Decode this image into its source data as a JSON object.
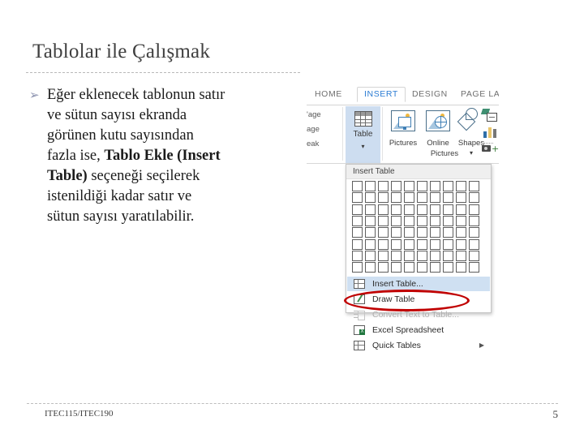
{
  "slide": {
    "title": "Tablolar ile Çalışmak",
    "bullet_marker": "➢",
    "body_lines": [
      {
        "text": "Eğer eklenecek tablonun satır",
        "bold": false
      },
      {
        "text": "ve sütun sayısı ekranda",
        "bold": false
      },
      {
        "text": "görünen kutu sayısından",
        "bold": false
      },
      {
        "text": "fazla ise, ",
        "bold": false,
        "bold_tail": "Tablo Ekle (Insert"
      },
      {
        "text": "Table)",
        "bold": true,
        "tail": " seçeneği seçilerek"
      },
      {
        "text": "istenildiği kadar satır ve",
        "bold": false
      },
      {
        "text": "sütun sayısı yaratılabilir.",
        "bold": false
      }
    ],
    "body_plain": "Eğer eklenecek tablonun satır ve sütun sayısı ekranda görünen kutu sayısından fazla ise, Tablo Ekle (Insert Table) seçeneği seçilerek istenildiği kadar satır ve sütun sayısı yaratılabilir."
  },
  "footer": {
    "course_code": "ITEC115/ITEC190",
    "page_number": "5"
  },
  "screenshot": {
    "app": "Microsoft Word 2013",
    "ribbon_tabs": [
      {
        "label": "HOME",
        "active": false
      },
      {
        "label": "INSERT",
        "active": true
      },
      {
        "label": "DESIGN",
        "active": false
      },
      {
        "label": "PAGE LA",
        "active": false,
        "truncated": true
      }
    ],
    "pages_group_truncated": [
      "'age",
      "age",
      "eak"
    ],
    "table_button": {
      "label": "Table",
      "caret": "▾",
      "state": "pressed"
    },
    "illustrations": [
      {
        "label": "Pictures",
        "icon": "pictures-icon"
      },
      {
        "label": "Online",
        "label2": "Pictures",
        "icon": "online-pictures-icon"
      },
      {
        "label": "Shapes",
        "icon": "shapes-icon",
        "caret": "▾"
      }
    ],
    "edge_icons": [
      {
        "name": "smartart-icon"
      },
      {
        "name": "chart-icon"
      },
      {
        "name": "screenshot-icon"
      }
    ],
    "menu": {
      "header": "Insert Table",
      "grid": {
        "columns": 10,
        "rows": 8,
        "highlighted": 0
      },
      "items": [
        {
          "label": "Insert Table...",
          "icon": "insert-table-icon",
          "selected": true,
          "disabled": false,
          "submenu": false
        },
        {
          "label": "Draw Table",
          "icon": "draw-table-icon",
          "selected": false,
          "disabled": false,
          "submenu": false
        },
        {
          "label": "Convert Text to Table...",
          "icon": "convert-text-icon",
          "selected": false,
          "disabled": true,
          "submenu": false
        },
        {
          "label": "Excel Spreadsheet",
          "icon": "excel-spreadsheet-icon",
          "selected": false,
          "disabled": false,
          "submenu": false
        },
        {
          "label": "Quick Tables",
          "icon": "quick-tables-icon",
          "selected": false,
          "disabled": false,
          "submenu": true,
          "submenu_arrow": "▶"
        }
      ]
    },
    "annotation": {
      "shape": "ellipse",
      "color": "#c00000",
      "targets": "Insert Table..."
    }
  },
  "colors": {
    "title": "#404040",
    "accent_tab": "#2b7cd3",
    "ribbon_highlight": "#cdddf0",
    "menu_selected": "#cfe0f2",
    "annotation_red": "#c00000",
    "bullet": "#8d93b0"
  }
}
